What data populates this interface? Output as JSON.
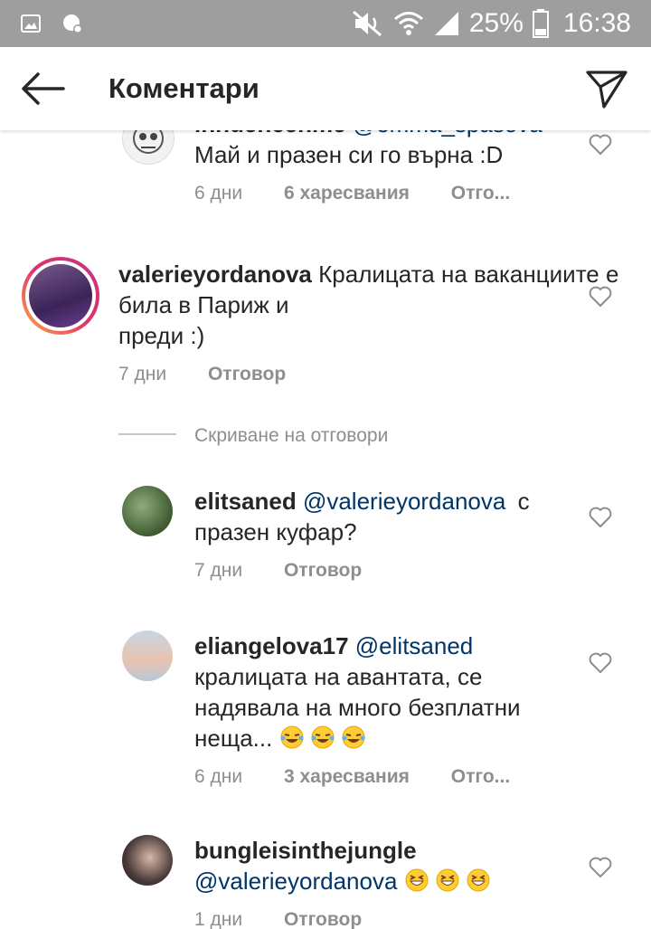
{
  "status_bar": {
    "battery": "25%",
    "time": "16:38"
  },
  "header": {
    "title": "Коментари"
  },
  "comments": [
    {
      "username": "innuencenme",
      "mention": "@emma_spasova",
      "text": "Май и празен си го върна :D",
      "time": "6 дни",
      "likes": "6 харесвания",
      "reply": "Отго..."
    },
    {
      "username": "valerieyordanova",
      "text": "Кралицата на ваканциите е била в Париж и",
      "text2": "преди :)",
      "time": "7 дни",
      "reply": "Отговор"
    },
    {
      "username": "elitsaned",
      "mention": "@valerieyordanova",
      "text": "с",
      "text2": "празен куфар?",
      "time": "7 дни",
      "reply": "Отговор"
    },
    {
      "username": "eliangelova17",
      "mention": "@elitsaned",
      "text": "кралицата на авантата, се",
      "text2": "надявала на много безплатни",
      "text3": "неща...",
      "time": "6 дни",
      "likes": "3 харесвания",
      "reply": "Отго..."
    },
    {
      "username": "bungleisinthejungle",
      "mention": "@valerieyordanova",
      "time": "1 дни",
      "reply": "Отговор"
    }
  ],
  "replies_toggle": "Скриване на отговори",
  "colors": {
    "status_bar": "#9e9e9e",
    "mention": "#003569",
    "meta": "#8e8e8e",
    "ring_start": "#c13584",
    "ring_end": "#fcaf45"
  }
}
